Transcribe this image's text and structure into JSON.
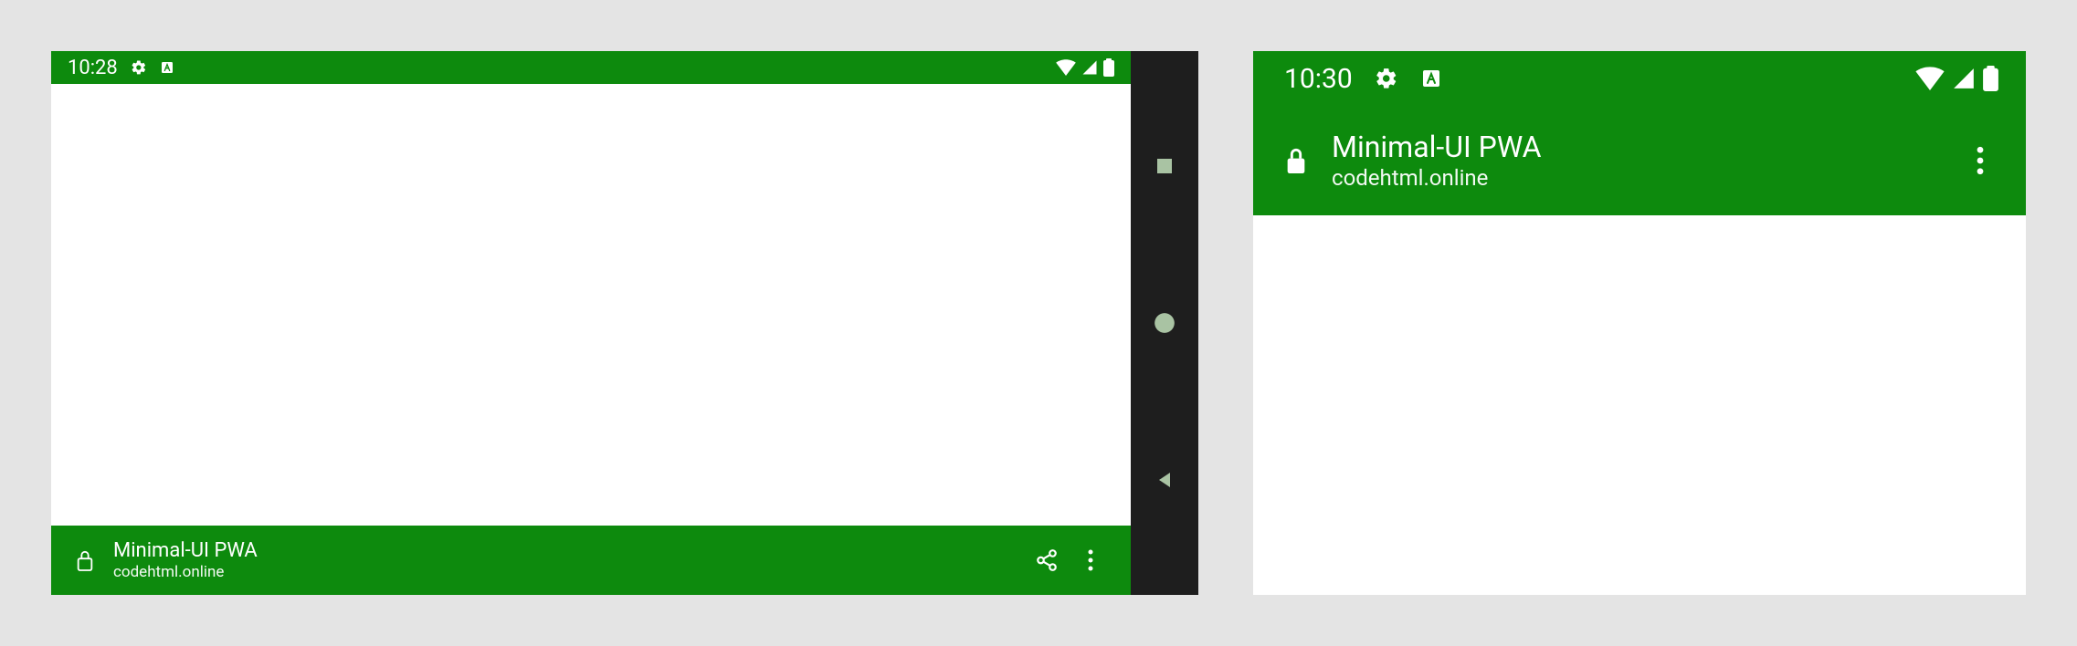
{
  "colors": {
    "accent": "#0d8a0d",
    "navbar": "#1e1e1e",
    "navicon": "#a9c3a3",
    "bg": "#e4e4e4"
  },
  "left": {
    "status": {
      "time": "10:28"
    },
    "app": {
      "title": "Minimal-UI PWA",
      "domain": "codehtml.online"
    }
  },
  "right": {
    "status": {
      "time": "10:30"
    },
    "app": {
      "title": "Minimal-UI PWA",
      "domain": "codehtml.online"
    }
  }
}
